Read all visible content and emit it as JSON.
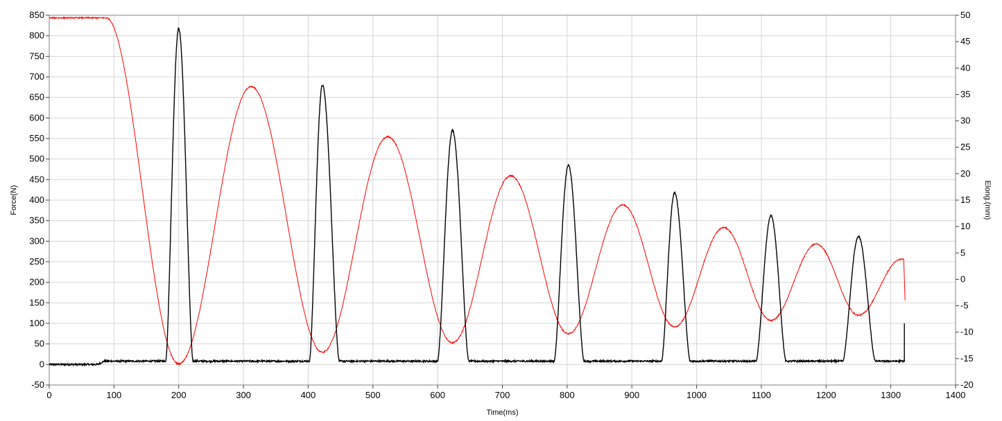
{
  "chart_data": {
    "type": "line",
    "title": "",
    "xlabel": "Time(ms)",
    "ylabel": "Force(N)",
    "y2label": "Elong.(mm)",
    "xlim": [
      0,
      1400
    ],
    "ylim": [
      -50,
      850
    ],
    "y2lim": [
      -20,
      50
    ],
    "x_ticks": [
      0,
      100,
      200,
      300,
      400,
      500,
      600,
      700,
      800,
      900,
      1000,
      1100,
      1200,
      1300,
      1400
    ],
    "y_ticks": [
      -50,
      0,
      50,
      100,
      150,
      200,
      250,
      300,
      350,
      400,
      450,
      500,
      550,
      600,
      650,
      700,
      750,
      800,
      850
    ],
    "y2_ticks": [
      -20,
      -15,
      -10,
      -5,
      0,
      5,
      10,
      15,
      20,
      25,
      30,
      35,
      40,
      45,
      50
    ],
    "grid": true,
    "legend": "none",
    "series": [
      {
        "axis": "left",
        "color": "#000000",
        "baseline_segments": [
          [
            0,
            0,
            75,
            0
          ],
          [
            75,
            0,
            85,
            8
          ],
          [
            85,
            8,
            1320,
            8
          ]
        ],
        "peaks": [
          {
            "start": 180,
            "peak_x": 200,
            "peak_y": 818,
            "end": 222
          },
          {
            "start": 402,
            "peak_x": 422,
            "peak_y": 680,
            "end": 448
          },
          {
            "start": 600,
            "peak_x": 623,
            "peak_y": 570,
            "end": 648
          },
          {
            "start": 780,
            "peak_x": 802,
            "peak_y": 485,
            "end": 826
          },
          {
            "start": 946,
            "peak_x": 966,
            "peak_y": 418,
            "end": 990
          },
          {
            "start": 1092,
            "peak_x": 1115,
            "peak_y": 362,
            "end": 1138
          },
          {
            "start": 1226,
            "peak_x": 1250,
            "peak_y": 312,
            "end": 1276
          }
        ],
        "end_spike": {
          "x": 1321,
          "y": 100
        }
      },
      {
        "axis": "right",
        "color": "#ff0000",
        "plateau": {
          "x_end": 88,
          "y": 49.5
        },
        "fall_to_first_min": {
          "x": 200,
          "y": -16.0
        },
        "min_points": [
          [
            200,
            -16.0
          ],
          [
            422,
            -13.8
          ],
          [
            623,
            -12.0
          ],
          [
            802,
            -10.3
          ],
          [
            966,
            -9.0
          ],
          [
            1115,
            -7.8
          ],
          [
            1250,
            -6.8
          ]
        ],
        "max_points": [
          [
            312,
            36.5
          ],
          [
            523,
            27.0
          ],
          [
            713,
            19.6
          ],
          [
            886,
            14.1
          ],
          [
            1042,
            9.8
          ],
          [
            1185,
            6.7
          ]
        ],
        "end": {
          "x_flat_start": 1316,
          "x_end": 1320,
          "y": 3.8,
          "drop_x": 1322,
          "drop_y": -4.0
        }
      }
    ]
  }
}
